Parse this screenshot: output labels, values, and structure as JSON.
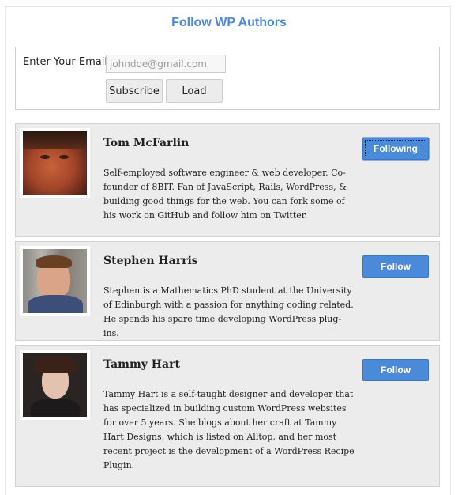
{
  "widget": {
    "title": "Follow WP Authors"
  },
  "form": {
    "email_label": "Enter Your Email",
    "email_placeholder": "johndoe@gmail.com",
    "email_value": "",
    "subscribe_label": "Subscribe",
    "load_label": "Load"
  },
  "authors": [
    {
      "name": "Tom McFarlin",
      "bio": "Self-employed software engineer & web developer. Co-founder of 8BIT. Fan of JavaScript, Rails, WordPress, & building good things for the web. You can fork some of his work on GitHub and follow him on Twitter.",
      "button_label": "Following",
      "following": true
    },
    {
      "name": "Stephen Harris",
      "bio": "Stephen is a Mathematics PhD student at the University of Edinburgh with a passion for anything coding related. He spends his spare time developing WordPress plug-ins.",
      "button_label": "Follow",
      "following": false
    },
    {
      "name": "Tammy Hart",
      "bio": "Tammy Hart is a self-taught designer and developer that has specialized in building custom WordPress websites for over 5 years. She blogs about her craft at Tammy Hart Designs, which is listed on Alltop, and her most recent project is the development of a WordPress Recipe Plugin.",
      "button_label": "Follow",
      "following": false
    }
  ],
  "colors": {
    "accent": "#4a8ad8",
    "card_background": "#ececec"
  }
}
